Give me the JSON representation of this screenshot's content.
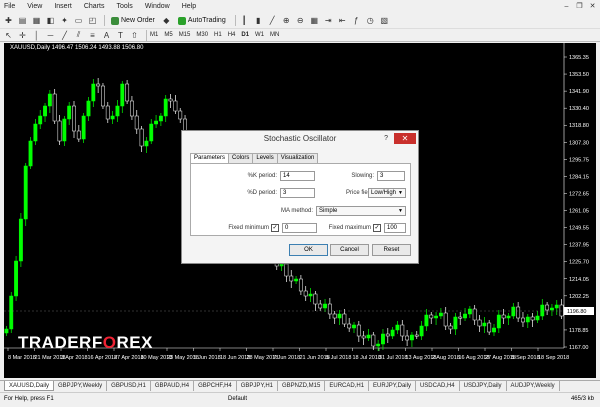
{
  "menu": [
    "File",
    "View",
    "Insert",
    "Charts",
    "Tools",
    "Window",
    "Help"
  ],
  "toolbar": {
    "new_order": "New Order",
    "autotrading": "AutoTrading"
  },
  "timeframes": [
    "M1",
    "M5",
    "M15",
    "M30",
    "H1",
    "H4",
    "D1",
    "W1",
    "MN"
  ],
  "chart": {
    "symbol_line": "XAUUSD,Daily  1496.47 1506.24 1493.88 1506.80",
    "price_labels": [
      "1365.35",
      "1353.50",
      "1341.90",
      "1330.40",
      "1318.80",
      "1307.30",
      "1295.75",
      "1284.15",
      "1272.65",
      "1261.05",
      "1249.55",
      "1237.95",
      "1225.70",
      "1214.05",
      "1202.25",
      "1190.70",
      "1178.85",
      "1167.00"
    ],
    "date_labels": [
      "8 Mar 2018",
      "21 Mar 2018",
      "3 Apr 2018",
      "16 Apr 2018",
      "27 Apr 2018",
      "10 May 2018",
      "23 May 2018",
      "5 Jun 2018",
      "18 Jun 2018",
      "28 May 2018",
      "7 Jun 2018",
      "21 Jun 2018",
      "5 Jul 2018",
      "18 Jul 2018",
      "31 Jul 2018",
      "13 Aug 2018",
      "2 Aug 2018",
      "16 Aug 2018",
      "27 Aug 2018",
      "5 Sep 2018",
      "18 Sep 2018"
    ],
    "current_price": "1196.80"
  },
  "dialog": {
    "title": "Stochastic Oscillator",
    "help": "?",
    "close": "✕",
    "tabs": [
      "Parameters",
      "Colors",
      "Levels",
      "Visualization"
    ],
    "k_period_label": "%K period:",
    "k_period": "14",
    "d_period_label": "%D period:",
    "d_period": "3",
    "slowing_label": "Slowing:",
    "slowing": "3",
    "price_field_label": "Price field:",
    "price_field": "Low/High",
    "ma_method_label": "MA method:",
    "ma_method": "Simple",
    "fixed_min_label": "Fixed minimum",
    "fixed_min": "0",
    "fixed_max_label": "Fixed maximum",
    "fixed_max": "100",
    "check": "✓",
    "ok": "OK",
    "cancel": "Cancel",
    "reset": "Reset"
  },
  "logo": {
    "part1": "TRADERF",
    "o": "O",
    "part2": "REX"
  },
  "symbol_tabs": [
    "XAUUSD,Daily",
    "GBPJPY,Weekly",
    "GBPUSD,H1",
    "GBPAUD,H4",
    "GBPCHF,H4",
    "GBPJPY,H1",
    "GBPNZD,M15",
    "EURCAD,H1",
    "EURJPY,Daily",
    "USDCAD,H4",
    "USDJPY,Daily",
    "AUDJPY,Weekly"
  ],
  "status": {
    "help": "For Help, press F1",
    "profile": "Default",
    "traffic": "465/3 kb"
  },
  "colors": {
    "bull": "#00ff00",
    "bear": "#ffffff",
    "chart_bg": "#000000"
  }
}
